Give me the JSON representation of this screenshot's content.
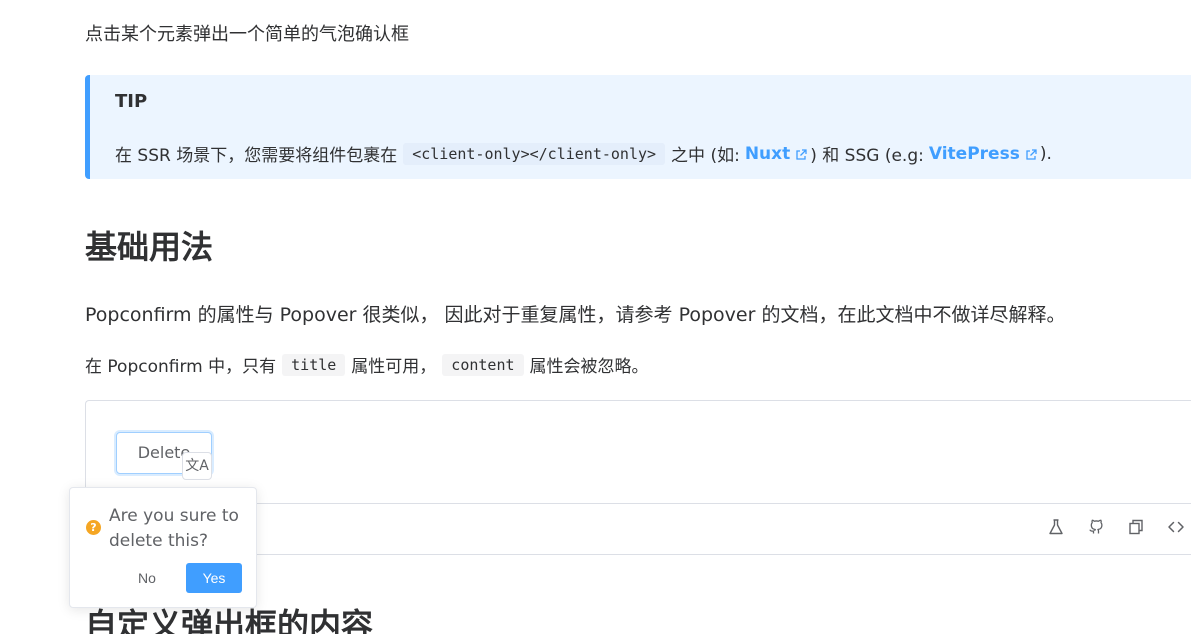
{
  "intro": "点击某个元素弹出一个简单的气泡确认框",
  "tip": {
    "title": "TIP",
    "text_before": "在 SSR 场景下，您需要将组件包裹在",
    "code": "<client-only></client-only>",
    "text_mid": "之中 (如:",
    "link1": "Nuxt",
    "text_mid2": ") 和 SSG (e.g:",
    "link2": "VitePress",
    "text_after": ")."
  },
  "heading": "基础用法",
  "paragraph1": "Popconfirm 的属性与 Popover 很类似， 因此对于重复属性，请参考 Popover 的文档，在此文档中不做详尽解释。",
  "paragraph2": {
    "before": "在 Popconfirm 中，只有",
    "code1": "title",
    "mid": "属性可用，",
    "code2": "content",
    "after": "属性会被忽略。"
  },
  "demo": {
    "button_label": "Delete",
    "translate_glyph": "文A",
    "toolbar_icons": [
      "flask-icon",
      "github-icon",
      "copy-icon",
      "code-icon"
    ]
  },
  "popconfirm": {
    "icon": "?",
    "title": "Are you sure to delete this?",
    "cancel": "No",
    "confirm": "Yes"
  },
  "next_heading": "自定义弹出框的内容",
  "colors": {
    "primary": "#409eff",
    "warning": "#f5a623",
    "tip_bg": "#ecf5ff"
  }
}
